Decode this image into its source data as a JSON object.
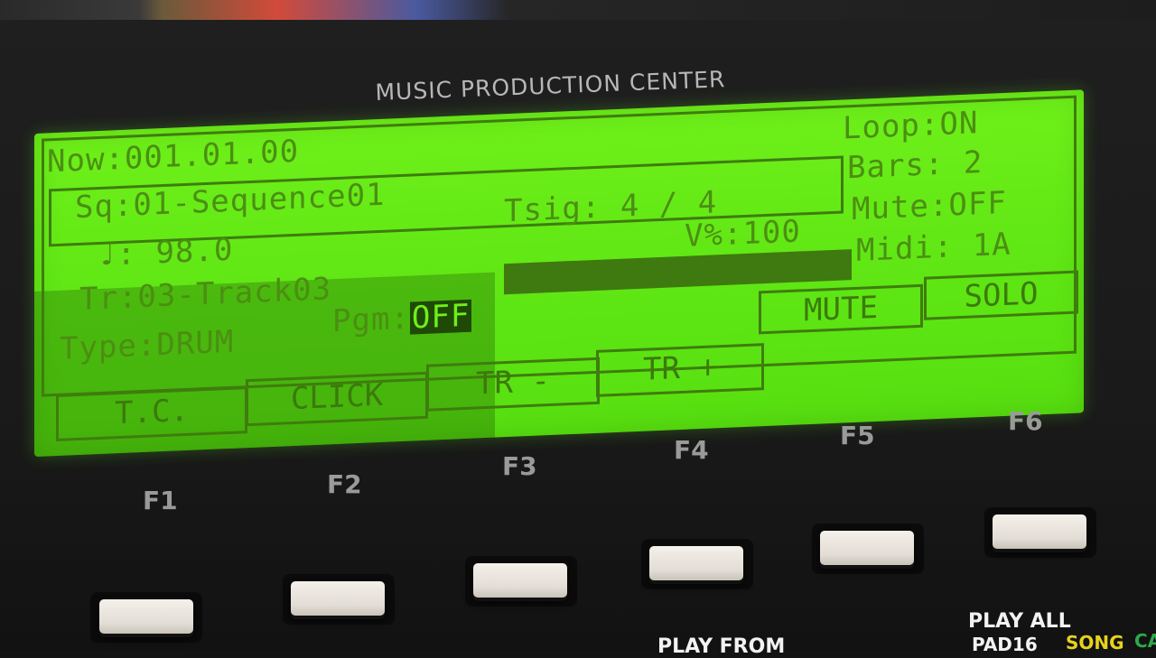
{
  "brand": "MUSIC PRODUCTION CENTER",
  "lcd": {
    "now": "Now:001.01.00",
    "loop": "Loop:ON",
    "bars": "Bars: 2",
    "sequence": "Sq:01-Sequence01",
    "tsig": "Tsig: 4 / 4",
    "tempo_symbol": "♩:",
    "tempo_value": "98.0",
    "velocity": "V%:100",
    "mute": "Mute:OFF",
    "track": "Tr:03-Track03",
    "midi": "Midi: 1A",
    "type": "Type:DRUM",
    "pgm_label": "Pgm:",
    "pgm_value": "OFF",
    "softkeys": [
      "MUTE",
      "SOLO"
    ],
    "fkeys": [
      "T.C.",
      "CLICK",
      "TR -",
      "TR +"
    ]
  },
  "function_labels": [
    "F1",
    "F2",
    "F3",
    "F4",
    "F5",
    "F6"
  ],
  "bottom": {
    "play_all": "PLAY ALL",
    "play_from": "PLAY FROM",
    "pad16": "PAD16",
    "song": "SONG",
    "cut": "CA"
  },
  "colors": {
    "lcd_bg": "#62e815",
    "lcd_text": "#4b8f12",
    "song": "#e6d21c",
    "cut": "#2ea84a"
  }
}
